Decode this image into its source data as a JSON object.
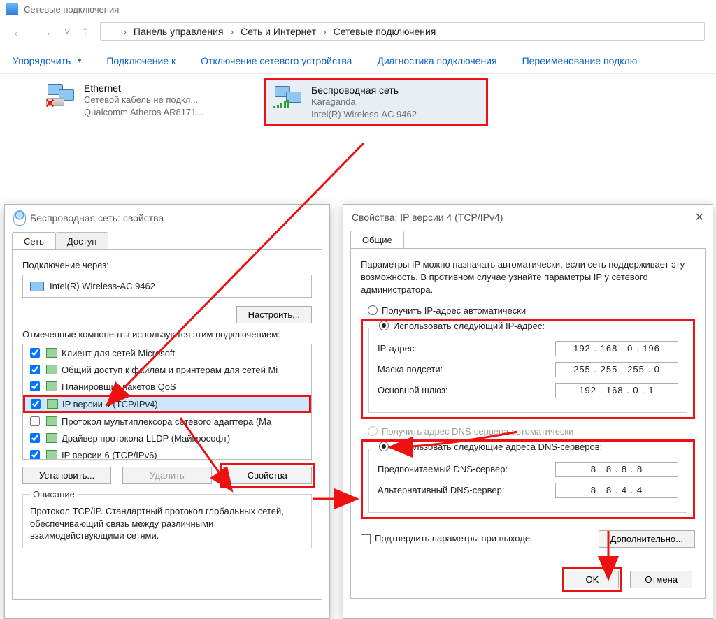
{
  "window": {
    "title": "Сетевые подключения"
  },
  "breadcrumb": {
    "root": "Панель управления",
    "mid": "Сеть и Интернет",
    "leaf": "Сетевые подключения"
  },
  "cmdbar": {
    "organize": "Упорядочить",
    "connect": "Подключение к",
    "disable": "Отключение сетевого устройства",
    "diagnose": "Диагностика подключения",
    "rename": "Переименование подклю"
  },
  "conn": {
    "eth": {
      "title": "Ethernet",
      "line1": "Сетевой кабель не подкл...",
      "line2": "Qualcomm Atheros AR8171..."
    },
    "wifi": {
      "title": "Беспроводная сеть",
      "line1": "Karaganda",
      "line2": "Intel(R) Wireless-AC 9462"
    }
  },
  "props": {
    "title": "Беспроводная сеть: свойства",
    "tab_net": "Сеть",
    "tab_share": "Доступ",
    "connect_via": "Подключение через:",
    "adapter": "Intel(R) Wireless-AC 9462",
    "configure": "Настроить...",
    "components_lbl": "Отмеченные компоненты используются этим подключением:",
    "items": [
      "Клиент для сетей Microsoft",
      "Общий доступ к файлам и принтерам для сетей Mi",
      "Планировщик пакетов QoS",
      "IP версии 4 (TCP/IPv4)",
      "Протокол мультиплексора сетевого адаптера (Ма",
      "Драйвер протокола LLDP (Майкрософт)",
      "IP версии 6 (TCP/IPv6)"
    ],
    "install": "Установить...",
    "uninstall": "Удалить",
    "properties": "Свойства",
    "desc_head": "Описание",
    "desc": "Протокол TCP/IP. Стандартный протокол глобальных сетей, обеспечивающий связь между различными взаимодействующими сетями."
  },
  "ipv4": {
    "title": "Свойства: IP версии 4 (TCP/IPv4)",
    "tab_general": "Общие",
    "intro": "Параметры IP можно назначать автоматически, если сеть поддерживает эту возможность. В противном случае узнайте параметры IP у сетевого администратора.",
    "r_auto": "Получить IP-адрес автоматически",
    "r_manual": "Использовать следующий IP-адрес:",
    "ip_lbl": "IP-адрес:",
    "mask_lbl": "Маска подсети:",
    "gw_lbl": "Основной шлюз:",
    "ip": "192 . 168 .  0  . 196",
    "mask": "255 . 255 . 255 .  0",
    "gw": "192 . 168 .  0  .  1",
    "r_dns_auto": "Получить адрес DNS-сервера автоматически",
    "r_dns_manual": "Использовать следующие адреса DNS-серверов:",
    "dns1_lbl": "Предпочитаемый DNS-сервер:",
    "dns2_lbl": "Альтернативный DNS-сервер:",
    "dns1": "8  .  8  .  8  .  8",
    "dns2": "8  .  8  .  4  .  4",
    "validate": "Подтвердить параметры при выходе",
    "advanced": "Дополнительно...",
    "ok": "OK",
    "cancel": "Отмена"
  }
}
